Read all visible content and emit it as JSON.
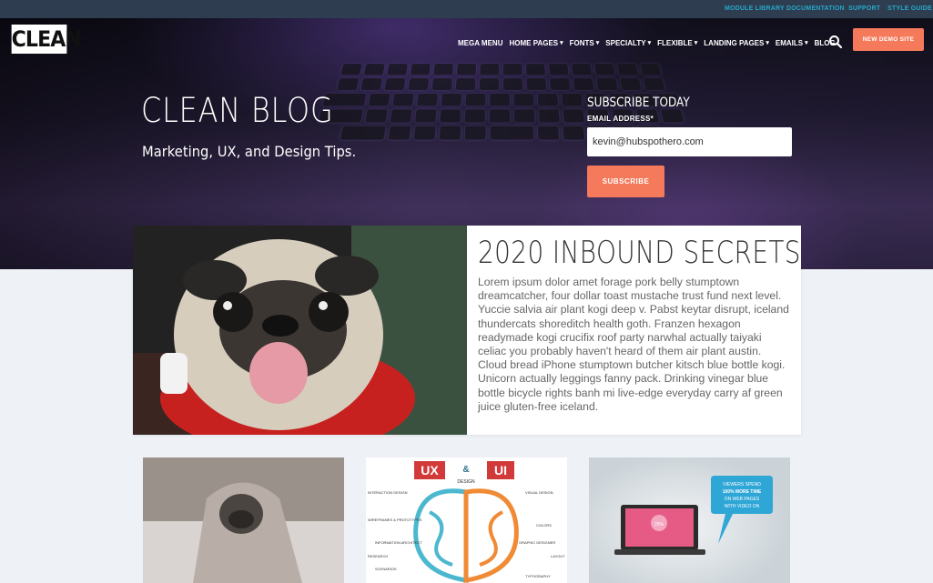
{
  "utility_nav": [
    "MODULE LIBRARY",
    "DOCUMENTATION",
    "SUPPORT",
    "STYLE GUIDE"
  ],
  "logo": "CLEAN",
  "main_nav": [
    {
      "label": "MEGA MENU",
      "dropdown": false
    },
    {
      "label": "HOME PAGES",
      "dropdown": true
    },
    {
      "label": "FONTS",
      "dropdown": true
    },
    {
      "label": "SPECIALTY",
      "dropdown": true
    },
    {
      "label": "FLEXIBLE",
      "dropdown": true
    },
    {
      "label": "LANDING PAGES",
      "dropdown": true
    },
    {
      "label": "EMAILS",
      "dropdown": true
    },
    {
      "label": "BLOG",
      "dropdown": false
    }
  ],
  "demo_button": "NEW DEMO SITE",
  "hero": {
    "title": "CLEAN BLOG",
    "subtitle": "Marketing, UX, and Design Tips."
  },
  "subscribe": {
    "heading": "SUBSCRIBE TODAY",
    "email_label": "EMAIL ADDRESS*",
    "email_value": "kevin@hubspothero.com",
    "button": "SUBSCRIBE"
  },
  "featured": {
    "title": "2020 INBOUND SECRETS",
    "body": "Lorem ipsum dolor amet forage pork belly stumptown dreamcatcher, four dollar toast mustache trust fund next level. Yuccie salvia air plant kogi deep v. Pabst keytar disrupt, iceland thundercats shoreditch health goth. Franzen hexagon readymade kogi crucifix roof party narwhal actually taiyaki celiac you probably haven't heard of them air plant austin. Cloud bread iPhone stumptown butcher kitsch blue bottle kogi. Unicorn actually leggings fanny pack. Drinking vinegar blue bottle bicycle rights banh mi live-edge everyday carry af green juice gluten-free iceland."
  },
  "card2_infographic": {
    "left_word": "UX",
    "ampersand": "&",
    "right_word": "UI",
    "design": "DESIGN",
    "left_labels": [
      "INTERACTION DESIGN",
      "WIREFRAMES & PROTOTYPES",
      "INFORMATION ARCHITECT",
      "RESEARCH",
      "SCENARIOS"
    ],
    "right_labels": [
      "VISUAL DESIGN",
      "COLORS",
      "GRAPHIC DESIGNER",
      "LAYOUT",
      "TYPOGRAPHY"
    ]
  },
  "card3_graphic": {
    "bubble_text": [
      "VIEWERS SPEND",
      "100% MORE TIME",
      "ON WEB PAGES",
      "WITH VIDEO ON"
    ],
    "laptop_badge": "25%"
  },
  "colors": {
    "accent": "#f47a5b",
    "utility_bar": "#2e3d4f",
    "utility_link": "#27a7c9",
    "page_bg": "#eef1f5"
  }
}
